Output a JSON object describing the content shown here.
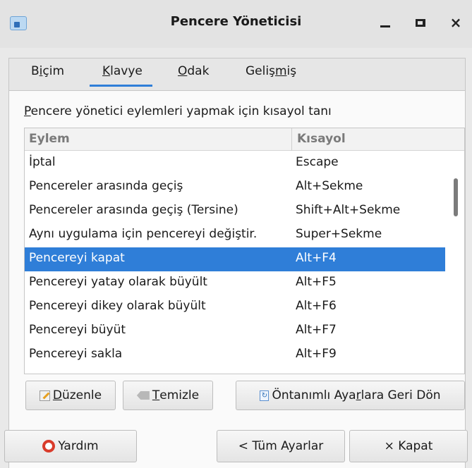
{
  "window": {
    "title": "Pencere Yöneticisi",
    "minimize_icon": "minimize-icon",
    "maximize_icon": "maximize-icon",
    "close_glyph": "×"
  },
  "tabs": [
    {
      "pre": "B",
      "u": "i",
      "post": "çim"
    },
    {
      "pre": "",
      "u": "K",
      "post": "lavye"
    },
    {
      "pre": "",
      "u": "O",
      "post": "dak"
    },
    {
      "pre": "Geliş",
      "u": "m",
      "post": "iş"
    }
  ],
  "active_tab": 1,
  "description": {
    "u": "P",
    "post": "encere yönetici eylemleri yapmak için kısayol tanı"
  },
  "list": {
    "headers": [
      "Eylem",
      "Kısayol"
    ],
    "rows": [
      {
        "action": "İptal",
        "shortcut": "Escape"
      },
      {
        "action": "Pencereler arasında geçiş",
        "shortcut": "Alt+Sekme"
      },
      {
        "action": "Pencereler arasında geçiş (Tersine)",
        "shortcut": "Shift+Alt+Sekme"
      },
      {
        "action": "Aynı uygulama için pencereyi değiştir.",
        "shortcut": "Super+Sekme"
      },
      {
        "action": "Pencereyi kapat",
        "shortcut": "Alt+F4"
      },
      {
        "action": "Pencereyi yatay olarak büyült",
        "shortcut": "Alt+F5"
      },
      {
        "action": "Pencereyi dikey olarak büyült",
        "shortcut": "Alt+F6"
      },
      {
        "action": "Pencereyi büyüt",
        "shortcut": "Alt+F7"
      },
      {
        "action": "Pencereyi sakla",
        "shortcut": "Alt+F9"
      }
    ],
    "selected_row": 4
  },
  "buttons": {
    "edit": {
      "u": "D",
      "post": "üzenle"
    },
    "clear": {
      "u": "T",
      "post": "emizle"
    },
    "reset": {
      "pre": "Öntanımlı Aya",
      "u": "r",
      "post": "lara Geri Dön"
    },
    "help": "Yardım",
    "all_settings": "< Tüm Ayarlar",
    "close": "× Kapat"
  },
  "colors": {
    "accent": "#2f7ed8"
  }
}
